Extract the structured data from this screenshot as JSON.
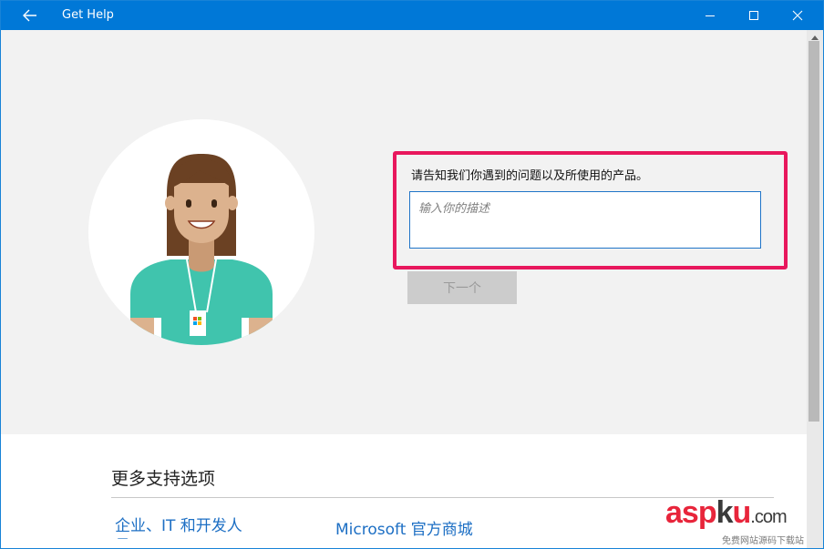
{
  "titlebar": {
    "title": "Get Help",
    "icons": [
      "back-arrow-icon",
      "minimize-icon",
      "maximize-icon",
      "close-icon"
    ]
  },
  "colors": {
    "accent": "#0078d7",
    "highlight_border": "#e8175d",
    "link": "#1d6fc4",
    "avatar_shirt": "#40c4ad",
    "avatar_hair": "#6b4123",
    "avatar_skin": "#dcb28e"
  },
  "hero": {
    "avatar": "support-agent-illustration",
    "prompt": "请告知我们你遇到的问题以及所使用的产品。",
    "description_placeholder": "输入你的描述",
    "description_value": "",
    "next_button": "下一个"
  },
  "more_support": {
    "heading": "更多支持选项",
    "links": [
      {
        "label": "企业、IT 和开发人员"
      },
      {
        "label": "Microsoft 官方商城"
      }
    ]
  },
  "watermark": {
    "logo_red_1": "asp",
    "logo_dark": "k",
    "logo_red_2": "u",
    "logo_suffix": ".com",
    "subtitle": "免费网站源码下载站"
  }
}
